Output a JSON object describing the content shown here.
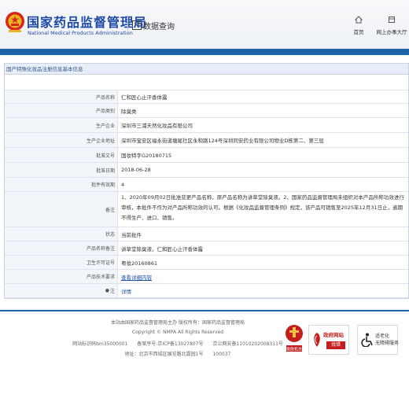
{
  "header": {
    "brand_cn": "国家药品监督管理局",
    "brand_en": "National Medical Products Administration",
    "query_title": "数据查询",
    "nav": [
      {
        "label": "首页",
        "icon": "home-icon"
      },
      {
        "label": "网上办事大厅",
        "icon": "building-icon"
      }
    ],
    "accent_color": "#1c63a8",
    "brand_color": "#1e4aa8"
  },
  "panel": {
    "title": "国产特殊化妆品注册信息基本信息",
    "rows": [
      {
        "label": "产品名称",
        "value": "仁和匠心止汗香体露"
      },
      {
        "label": "产品类别",
        "value": "除臭类"
      },
      {
        "label": "生产企业",
        "value": "深圳市三浦天然化妆品有限公司"
      },
      {
        "label": "生产企业地址",
        "value": "深圳市宝安区福永街道塘尾社区永和路124号深圳同安药业有限公司物业D栋第二、第三层"
      },
      {
        "label": "批准文号",
        "value": "国妆特字G20180715"
      },
      {
        "label": "批准日期",
        "value": "2018-06-28"
      },
      {
        "label": "批件有效期",
        "value": "4"
      },
      {
        "label": "备注",
        "value": "1、2020年09月02日批准变更产品名称，原产品名称为讲草堂除臭液。2、国家药品监督管理局未组织对本产品所称功效进行审核，本批件不作为对产品所称功效的认可。根据《化妆品监督管理条例》规定，该产品可销售至2025年12月31日止，逾期不得生产、进口、销售。"
      },
      {
        "label": "状态",
        "value": "当前批件"
      },
      {
        "label": "产品名称备注",
        "value": "讲草堂除臭液，仁和匠心止汗香体露"
      },
      {
        "label": "卫生许可证号",
        "value": "粤妆20160861"
      },
      {
        "label": "产品技术要求",
        "value": "查看详细内容"
      },
      {
        "label": "注",
        "value": "详情"
      }
    ]
  },
  "footer": {
    "sponsor": "本站由国家药品监督管理局主办 版权所有：国家药品监督管理局",
    "copyright": "Copyright © NMPA All Rights Reserved",
    "record": "网站标识码bm35000001　　备案序号:京ICP备13027807号　　京公网安备11010202008311号",
    "address": "地址：北京市西城区展览路北露园1号　　100037",
    "badges": [
      {
        "label": "党政机关",
        "icon": "party-emblem-icon"
      },
      {
        "label": "政府网站",
        "sub": "找错",
        "icon": "gov-site-icon"
      },
      {
        "label": "适老化",
        "sub": "无障碍服务",
        "icon": "accessibility-icon"
      }
    ]
  }
}
